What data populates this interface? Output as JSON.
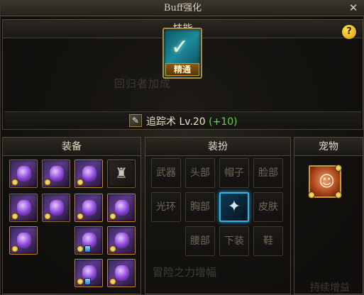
{
  "window": {
    "title": "Buff强化",
    "close_glyph": "✕"
  },
  "skill": {
    "header": "技能",
    "help_glyph": "?",
    "badge": "精通",
    "watermark": "回归者加成",
    "name": "追踪术",
    "level_text": "Lv.20",
    "bonus_text": "(+10)",
    "mini_icon": "skill-mini-icon",
    "accent_color": "#5fd83a"
  },
  "equipment": {
    "header": "装备",
    "slots": [
      {
        "name": "equip-slot-weapon"
      },
      {
        "name": "equip-slot-title"
      },
      {
        "name": "equip-slot-shoulder"
      },
      {
        "name": "equip-slot-jacket"
      },
      {
        "name": "equip-slot-pants"
      },
      {
        "name": "equip-slot-belt"
      },
      {
        "name": "equip-slot-shoes"
      },
      {
        "name": "equip-slot-bracelet"
      },
      {
        "name": "equip-slot-necklace"
      },
      {
        "name": "equip-slot-ring"
      },
      {
        "name": "equip-slot-support"
      },
      {
        "name": "equip-slot-magic-stone"
      },
      {
        "name": "equip-slot-earring"
      },
      {
        "name": "equip-slot-extra"
      }
    ]
  },
  "outfit": {
    "header": "装扮",
    "slots": [
      {
        "label": "武器"
      },
      {
        "label": "头部"
      },
      {
        "label": "帽子"
      },
      {
        "label": "脸部"
      },
      {
        "label": "光环"
      },
      {
        "label": "胸部"
      },
      {
        "label": ""
      },
      {
        "label": "皮肤"
      },
      {
        "label": "腰部"
      },
      {
        "label": "下装"
      },
      {
        "label": "鞋"
      }
    ],
    "watermark": "冒险之力增幅"
  },
  "pet": {
    "header": "宠物",
    "watermark": "持续增益"
  }
}
